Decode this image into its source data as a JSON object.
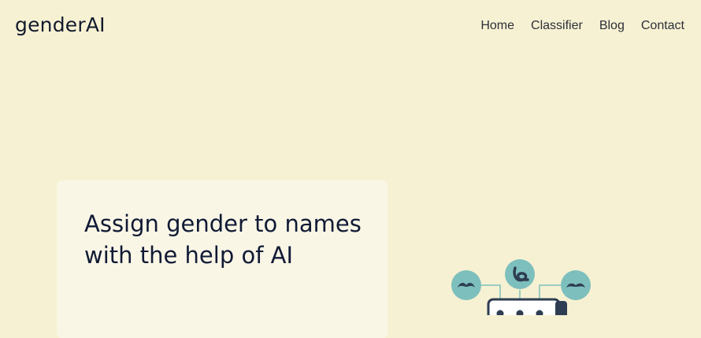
{
  "header": {
    "logo": "genderAI",
    "nav": [
      {
        "label": "Home"
      },
      {
        "label": "Classifier"
      },
      {
        "label": "Blog"
      },
      {
        "label": "Contact"
      }
    ]
  },
  "hero": {
    "title": "Assign gender to names with the help of AI"
  },
  "illustration": {
    "icons": [
      "mustache-icon",
      "lips-icon",
      "mustache-icon",
      "device-icon"
    ]
  },
  "colors": {
    "background": "#f7f1d3",
    "card": "#faf6e6",
    "text": "#101a35",
    "bubble": "#7dbfbc",
    "dark": "#2e3d52"
  }
}
